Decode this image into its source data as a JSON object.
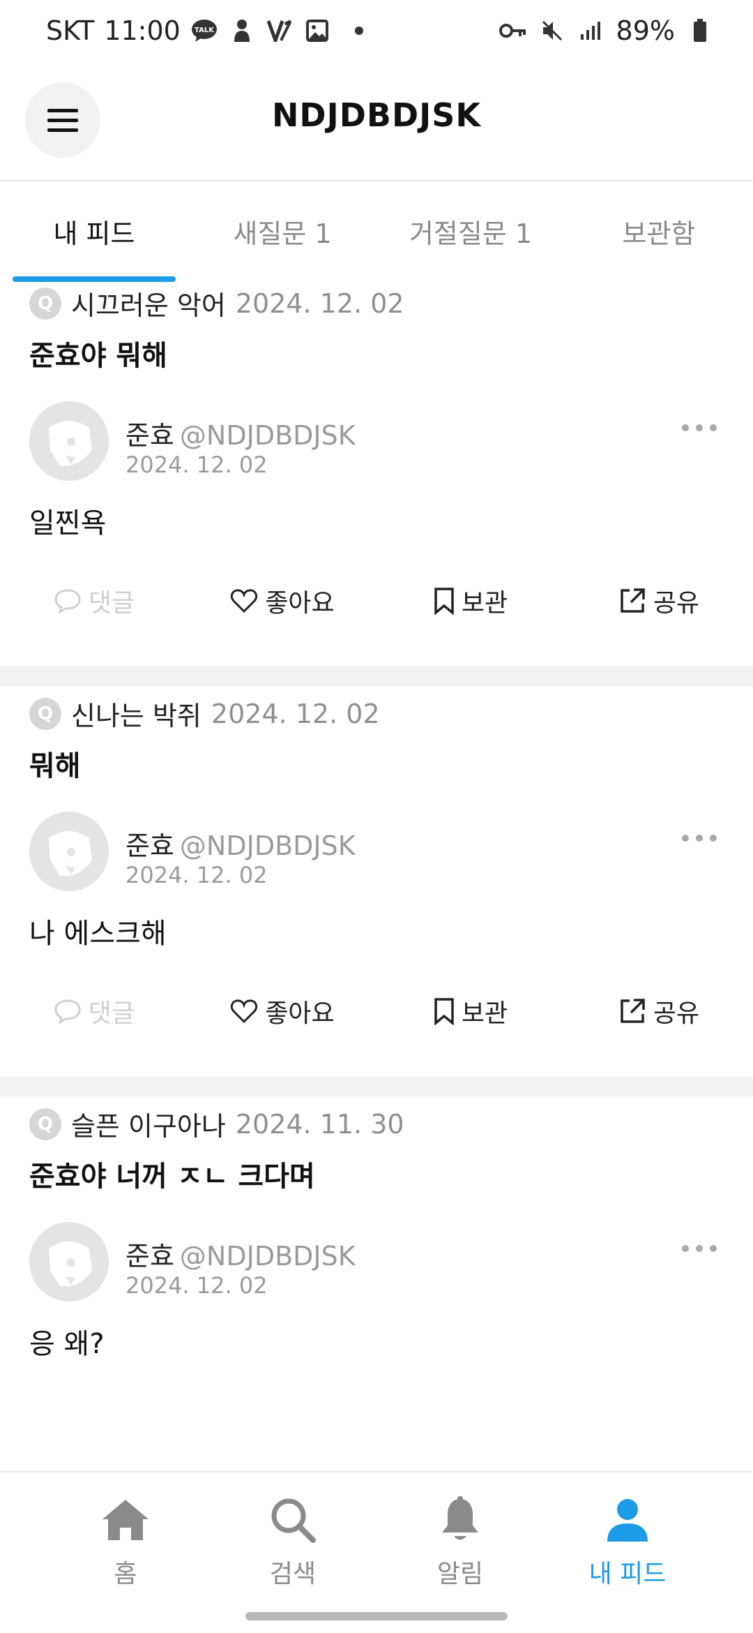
{
  "status_bar": {
    "carrier": "SKT",
    "time": "11:00",
    "battery": "89%",
    "left_icons": [
      "talk-icon",
      "pet-icon",
      "vpn-icon",
      "gallery-icon",
      "dot-icon"
    ],
    "right_icons": [
      "key-icon",
      "mute-icon",
      "signal-icon",
      "battery-icon"
    ]
  },
  "header": {
    "title": "NDJDBDJSK",
    "menu_icon": "hamburger-icon"
  },
  "tabs": [
    {
      "label": "내 피드",
      "active": true
    },
    {
      "label": "새질문 1",
      "active": false
    },
    {
      "label": "거절질문 1",
      "active": false
    },
    {
      "label": "보관함",
      "active": false
    }
  ],
  "accent_color": "#1e9be6",
  "posts": [
    {
      "q_badge": "Q",
      "asker": "시끄러운 악어",
      "asked_date": "2024. 12. 02",
      "question": "준효야 뭐해",
      "author_name": "준효",
      "author_handle": "@NDJDBDJSK",
      "answered_date": "2024. 12. 02",
      "answer": "일찐욕",
      "actions": {
        "comment": "댓글",
        "like": "좋아요",
        "save": "보관",
        "share": "공유"
      }
    },
    {
      "q_badge": "Q",
      "asker": "신나는 박쥐",
      "asked_date": "2024. 12. 02",
      "question": "뭐해",
      "author_name": "준효",
      "author_handle": "@NDJDBDJSK",
      "answered_date": "2024. 12. 02",
      "answer": "나 에스크해",
      "actions": {
        "comment": "댓글",
        "like": "좋아요",
        "save": "보관",
        "share": "공유"
      }
    },
    {
      "q_badge": "Q",
      "asker": "슬픈 이구아나",
      "asked_date": "2024. 11. 30",
      "question": "준효야 너꺼 ㅈㄴ 크다며",
      "author_name": "준효",
      "author_handle": "@NDJDBDJSK",
      "answered_date": "2024. 12. 02",
      "answer": "응 왜?"
    }
  ],
  "bottom_nav": [
    {
      "label": "홈",
      "icon": "home-icon",
      "active": false
    },
    {
      "label": "검색",
      "icon": "search-icon",
      "active": false
    },
    {
      "label": "알림",
      "icon": "bell-icon",
      "active": false
    },
    {
      "label": "내 피드",
      "icon": "person-icon",
      "active": true
    }
  ]
}
